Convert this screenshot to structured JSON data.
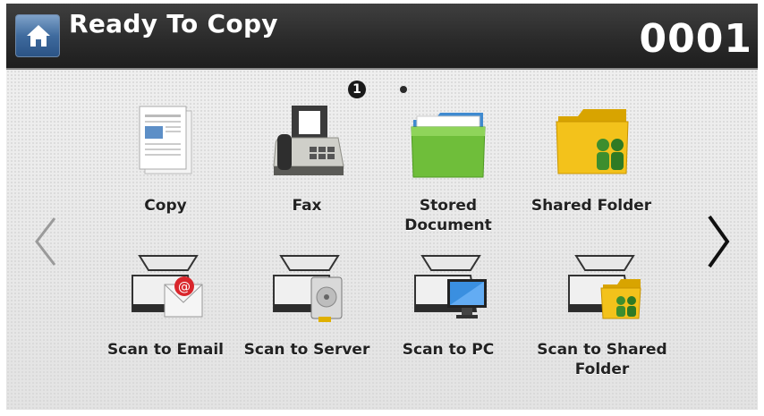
{
  "header": {
    "title": "Ready To Copy",
    "counter": "0001",
    "home_icon": "home-icon"
  },
  "pager": {
    "active_page": "1",
    "page_count": 2
  },
  "nav": {
    "prev_icon": "chevron-left-icon",
    "next_icon": "chevron-right-icon"
  },
  "apps": [
    {
      "label": "Copy",
      "icon": "copy-document-icon"
    },
    {
      "label": "Fax",
      "icon": "fax-machine-icon"
    },
    {
      "label": "Stored\nDocument",
      "icon": "green-folder-icon"
    },
    {
      "label": "Shared Folder",
      "icon": "shared-folder-icon"
    },
    {
      "label": "Scan to Email",
      "icon": "scan-email-icon"
    },
    {
      "label": "Scan to Server",
      "icon": "scan-server-icon"
    },
    {
      "label": "Scan to PC",
      "icon": "scan-pc-icon"
    },
    {
      "label": "Scan to Shared\nFolder",
      "icon": "scan-shared-folder-icon"
    }
  ],
  "colors": {
    "header_bg": "#2b2b2b",
    "home_button": "#3f6b9e",
    "body_bg": "#e7e7e7"
  }
}
